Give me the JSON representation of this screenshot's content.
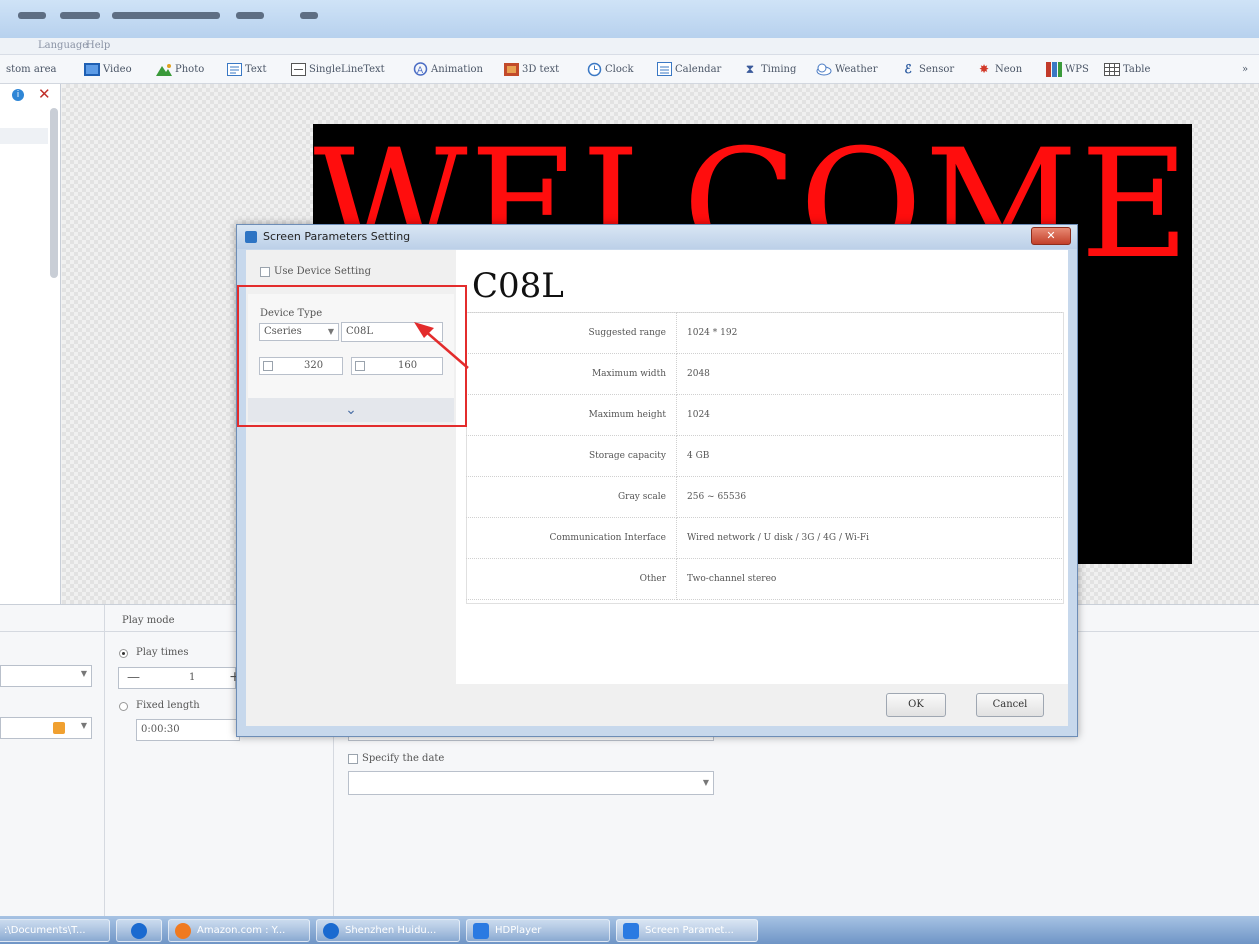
{
  "titlebar": {
    "blob_color": "#3b4a5e"
  },
  "menubar": {
    "items": [
      "Language",
      "Help"
    ]
  },
  "toolbar": {
    "items": [
      {
        "label": "stom area",
        "icon": ""
      },
      {
        "label": "Video",
        "icon": "video-icon"
      },
      {
        "label": "Photo",
        "icon": "photo-icon"
      },
      {
        "label": "Text",
        "icon": "text-icon"
      },
      {
        "label": "SingleLineText",
        "icon": "single-line-text-icon"
      },
      {
        "label": "Animation",
        "icon": "animation-icon"
      },
      {
        "label": "3D text",
        "icon": "3d-text-icon"
      },
      {
        "label": "Clock",
        "icon": "clock-icon"
      },
      {
        "label": "Calendar",
        "icon": "calendar-icon"
      },
      {
        "label": "Timing",
        "icon": "hourglass-icon"
      },
      {
        "label": "Weather",
        "icon": "weather-icon"
      },
      {
        "label": "Sensor",
        "icon": "sensor-icon"
      },
      {
        "label": "Neon",
        "icon": "neon-icon"
      },
      {
        "label": "WPS",
        "icon": "wps-icon"
      },
      {
        "label": "Table",
        "icon": "table-icon"
      }
    ],
    "overflow": "»"
  },
  "left_panel": {
    "info_icon": "i",
    "close_icon": "✕"
  },
  "led_preview": {
    "text": "WELCOME",
    "text_color": "#ff0d0d",
    "background": "#000000"
  },
  "bottom_panel": {
    "play_mode_label": "Play mode",
    "play_times_label": "Play times",
    "play_times_value": "1",
    "fixed_length_label": "Fixed length",
    "fixed_length_value": "0:00:30",
    "specify_date_label": "Specify the date"
  },
  "dialog": {
    "title": "Screen Parameters Setting",
    "close": "✕",
    "use_device_setting": "Use Device Setting",
    "device_type_label": "Device Type",
    "series_select": "Cseries",
    "model_input": "C08L",
    "width_value": "320",
    "height_value": "160",
    "expand_icon": "⌄",
    "device_name": "C08L",
    "specs": [
      {
        "key": "Suggested range",
        "value": "1024 * 192"
      },
      {
        "key": "Maximum width",
        "value": "2048"
      },
      {
        "key": "Maximum height",
        "value": "1024"
      },
      {
        "key": "Storage capacity",
        "value": "4 GB"
      },
      {
        "key": "Gray scale",
        "value": "256 ~ 65536"
      },
      {
        "key": "Communication Interface",
        "value": "Wired network / U disk / 3G / 4G / Wi-Fi"
      },
      {
        "key": "Other",
        "value": "Two-channel stereo"
      }
    ],
    "ok_label": "OK",
    "cancel_label": "Cancel"
  },
  "annotation": {
    "color": "#e32c2c"
  },
  "taskbar": {
    "items": [
      {
        "label": ":\\Documents\\T..."
      },
      {
        "label": ""
      },
      {
        "label": "Amazon.com : Y..."
      },
      {
        "label": "Shenzhen Huidu..."
      },
      {
        "label": "HDPlayer"
      },
      {
        "label": "Screen Paramet..."
      }
    ]
  }
}
